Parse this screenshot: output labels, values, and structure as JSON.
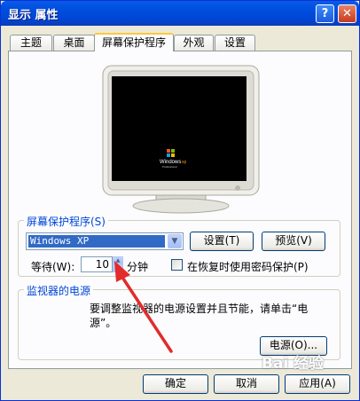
{
  "window": {
    "title": "显示 属性",
    "help_label": "?",
    "close_label": "✕"
  },
  "tabs": [
    {
      "label": "主题"
    },
    {
      "label": "桌面"
    },
    {
      "label": "屏幕保护程序"
    },
    {
      "label": "外观"
    },
    {
      "label": "设置"
    }
  ],
  "preview": {
    "logo_text": "Windows",
    "logo_xp": "xp",
    "logo_sub": "Professional"
  },
  "screensaver": {
    "group_label": "屏幕保护程序(S)",
    "selected": "Windows XP",
    "settings_button": "设置(T)",
    "preview_button": "预览(V)",
    "wait_label": "等待(W):",
    "wait_value": "10",
    "wait_unit": "分钟",
    "password_label": "在恢复时使用密码保护(P)"
  },
  "power": {
    "group_label": "监视器的电源",
    "description": "要调整监视器的电源设置并且节能，请单击“电源”。",
    "power_button": "电源(O)..."
  },
  "footer": {
    "ok_button": "确定",
    "cancel_button": "取消",
    "apply_button": "应用(A)"
  },
  "watermark": {
    "text": "Bai 经验"
  }
}
